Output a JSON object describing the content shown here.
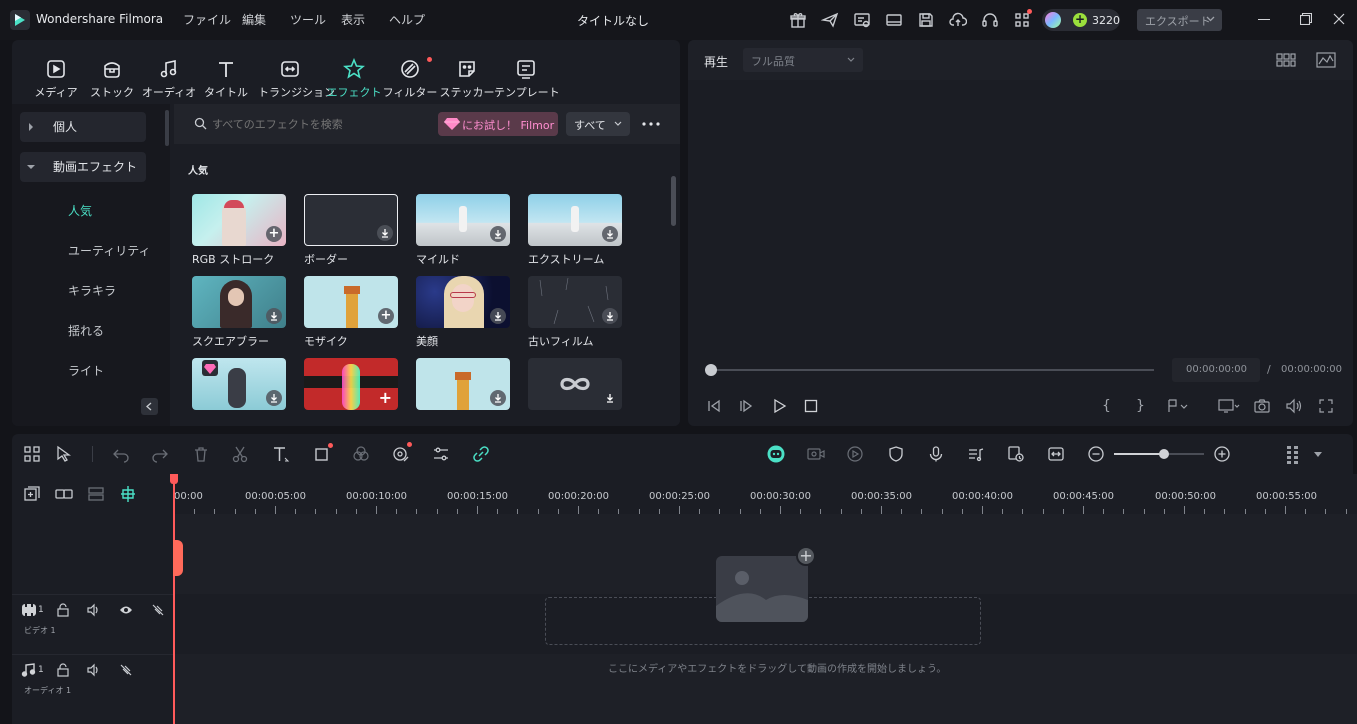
{
  "app": {
    "name": "Wondershare Filmora",
    "doc_title": "タイトルなし"
  },
  "menu": [
    "ファイル",
    "編集",
    "ツール",
    "表示",
    "ヘルプ"
  ],
  "credits": "3220",
  "export_label": "エクスポート",
  "library": {
    "tabs": [
      {
        "label": "メディア",
        "icon": "media-icon"
      },
      {
        "label": "ストック",
        "icon": "stock-icon"
      },
      {
        "label": "オーディオ",
        "icon": "audio-icon"
      },
      {
        "label": "タイトル",
        "icon": "title-icon"
      },
      {
        "label": "トランジション",
        "icon": "transition-icon"
      },
      {
        "label": "エフェクト",
        "icon": "effect-icon"
      },
      {
        "label": "フィルター",
        "icon": "filter-icon"
      },
      {
        "label": "ステッカー",
        "icon": "sticker-icon"
      },
      {
        "label": "テンプレート",
        "icon": "template-icon"
      }
    ],
    "sidebar": {
      "personal": "個人",
      "video_effects": "動画エフェクト",
      "subitems": [
        "人気",
        "ユーティリティ",
        "キラキラ",
        "揺れる",
        "ライト"
      ]
    },
    "search_placeholder": "すべてのエフェクトを検索",
    "promo": "にお試し！ Filmor",
    "filter_select": "すべて",
    "section_title": "人気",
    "effects": [
      "RGB ストローク",
      "ボーダー",
      "マイルド",
      "エクストリーム",
      "スクエアブラー",
      "モザイク",
      "美顔",
      "古いフィルム",
      "",
      "",
      "",
      ""
    ]
  },
  "preview": {
    "label": "再生",
    "quality": "フル品質",
    "current_time": "00:00:00:00",
    "separator": "/",
    "total_time": "00:00:00:00"
  },
  "timeline": {
    "ruler": [
      "00:00",
      "00:00:05:00",
      "00:00:10:00",
      "00:00:15:00",
      "00:00:20:00",
      "00:00:25:00",
      "00:00:30:00",
      "00:00:35:00",
      "00:00:40:00",
      "00:00:45:00",
      "00:00:50:00",
      "00:00:55:00"
    ],
    "video_track": "ビデオ 1",
    "audio_track": "オーディオ 1",
    "track_num": "1",
    "empty_hint": "ここにメディアやエフェクトをドラッグして動画の作成を開始しましょう。",
    "zoom_level": 0.55
  },
  "colors": {
    "accent": "#4be0c6",
    "playhead": "#ff5a5a",
    "export_bg": "#3a3d46"
  }
}
